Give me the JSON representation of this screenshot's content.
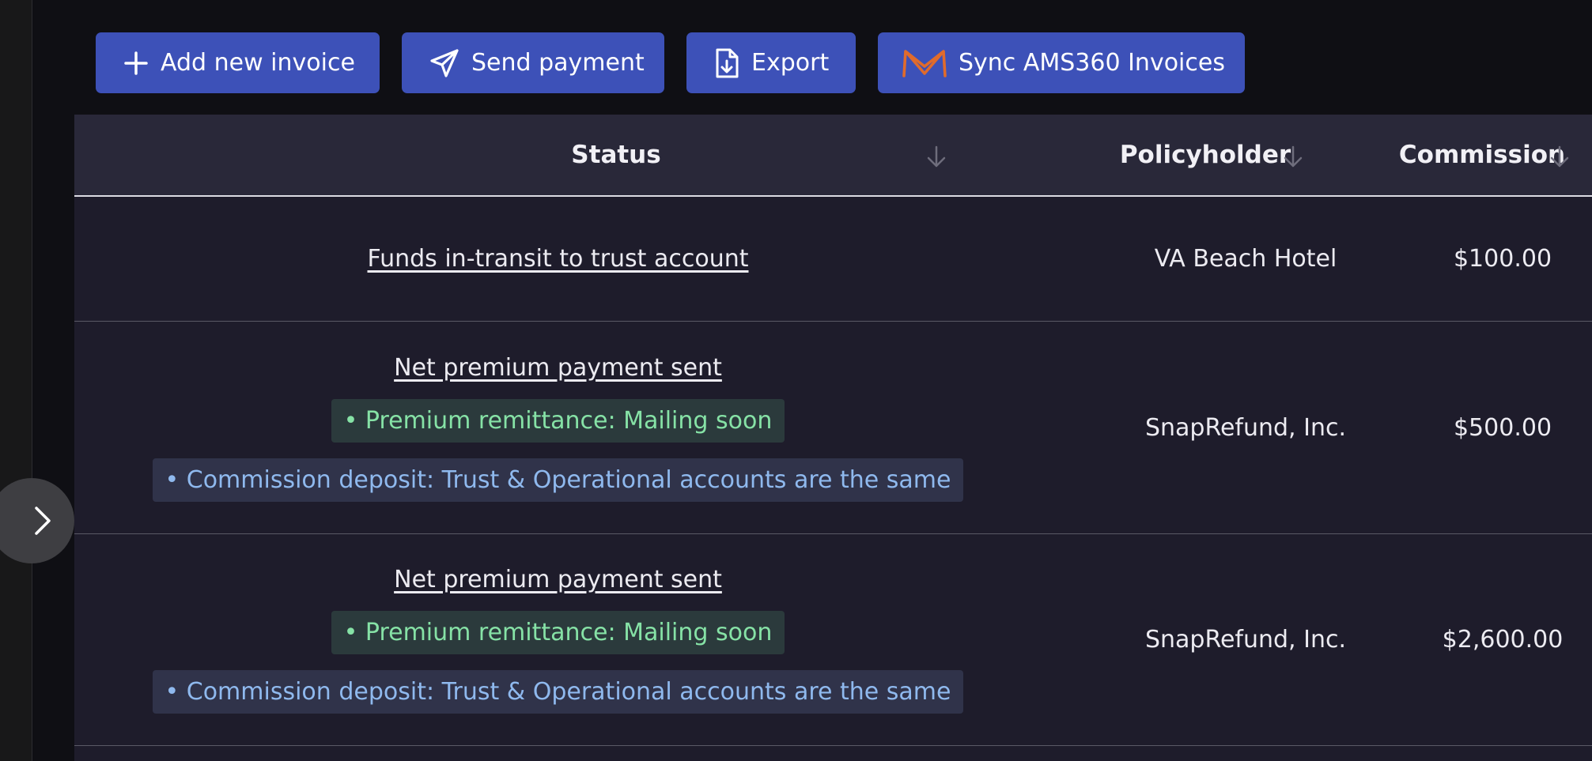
{
  "toolbar": {
    "add_invoice_label": "Add new invoice",
    "send_payment_label": "Send payment",
    "export_label": "Export",
    "sync_label": "Sync AMS360 Invoices"
  },
  "table": {
    "columns": [
      {
        "label": "Status",
        "icon": "arrow-down-icon"
      },
      {
        "label": "Policyholder",
        "icon": "arrow-down-icon"
      },
      {
        "label": "Commission",
        "icon": "arrow-down-icon"
      }
    ],
    "rows": [
      {
        "status": "Funds in-transit to trust account",
        "policyholder": "VA Beach Hotel",
        "commission": "$100.00"
      },
      {
        "status": "Net premium payment sent",
        "badge_remittance": "• Premium remittance: Mailing soon",
        "badge_deposit": "• Commission deposit: Trust & Operational accounts are the same",
        "policyholder": "SnapRefund, Inc.",
        "commission": "$500.00"
      },
      {
        "status": "Net premium payment sent",
        "badge_remittance": "• Premium remittance: Mailing soon",
        "badge_deposit": "• Commission deposit: Trust & Operational accounts are the same",
        "policyholder": "SnapRefund, Inc.",
        "commission": "$2,600.00"
      }
    ]
  },
  "colors": {
    "primary_button": "#3d51b8",
    "ams360_logo": "#e06b2c",
    "badge_green_text": "#86e2a6",
    "badge_blue_text": "#8fb9ee"
  },
  "icons": {
    "add": "plus-icon",
    "send": "paper-plane-icon",
    "export": "file-download-icon",
    "sync": "ams360-logo-icon",
    "sidebar_toggle": "chevron-right-icon"
  }
}
